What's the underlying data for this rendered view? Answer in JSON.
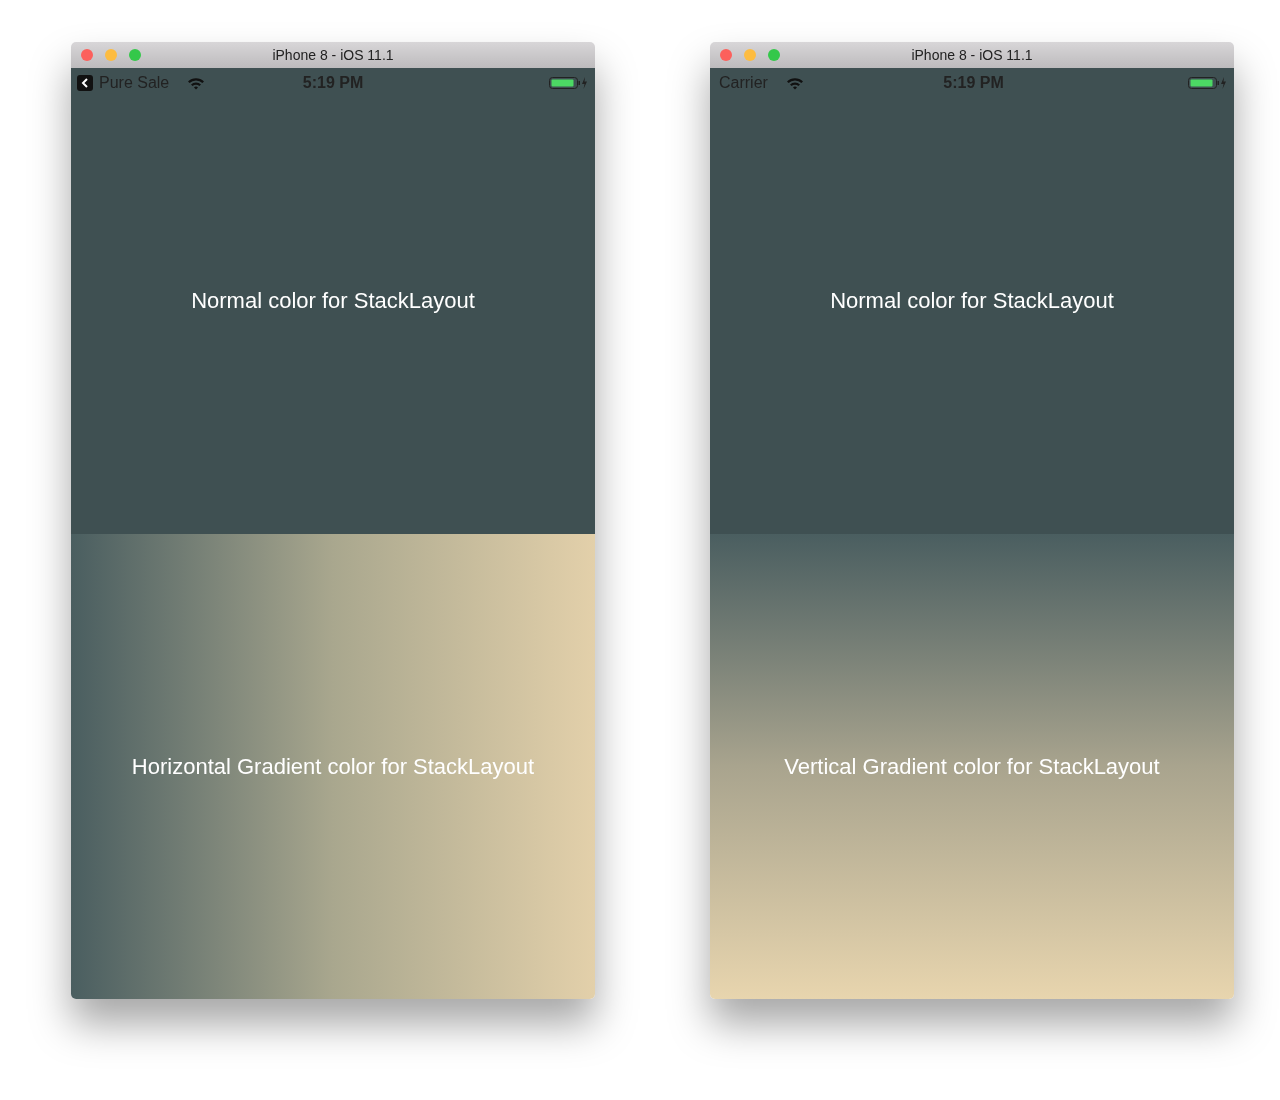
{
  "windows": [
    {
      "title": "iPhone 8 - iOS 11.1",
      "status_bar": {
        "left_item": {
          "kind": "back",
          "label": "Pure Sale"
        },
        "time": "5:19 PM"
      },
      "sections": [
        {
          "kind": "solid",
          "label": "Normal color for StackLayout"
        },
        {
          "kind": "horizontal",
          "label": "Horizontal Gradient color for StackLayout"
        }
      ]
    },
    {
      "title": "iPhone 8 - iOS 11.1",
      "status_bar": {
        "left_item": {
          "kind": "carrier",
          "label": "Carrier"
        },
        "time": "5:19 PM"
      },
      "sections": [
        {
          "kind": "solid",
          "label": "Normal color for StackLayout"
        },
        {
          "kind": "vertical",
          "label": "Vertical Gradient color for StackLayout"
        }
      ]
    }
  ]
}
